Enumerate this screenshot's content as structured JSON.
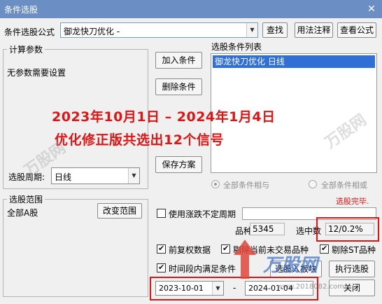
{
  "window": {
    "title": "条件选股",
    "close_glyph": "✕"
  },
  "formula": {
    "label": "条件选股公式",
    "value": "御龙快刀优化  -",
    "find_label": "查找",
    "usage_label": "用法注释",
    "view_label": "查看公式"
  },
  "params": {
    "legend": "计算参数",
    "note": "无参数需要设置"
  },
  "period": {
    "label": "选股周期:",
    "value": "日线"
  },
  "range": {
    "legend": "选股范围",
    "value": "全部A股",
    "change_label": "改变范围"
  },
  "actions": {
    "add_label": "加入条件",
    "remove_label": "删除条件",
    "save_label": "保存方案"
  },
  "conditions": {
    "legend": "选股条件列表",
    "items": [
      "御龙快刀优化  日线"
    ]
  },
  "logic": {
    "all_and_label": "全部条件相与",
    "all_or_label": "全部条件相或"
  },
  "status": {
    "done_text": "选股完毕."
  },
  "variable_period": {
    "label": "使用涨跌不定周期",
    "value": ""
  },
  "stats": {
    "count_label": "品种数",
    "count_value": "5345",
    "selected_label": "选中数",
    "selected_value": "12/0.2%"
  },
  "options": {
    "fq_label": "前复权数据",
    "exclude_untraded_label": "剔除当前未交易品种",
    "exclude_st_label": "剔除ST品种",
    "time_range_label": "时间段内满足条件"
  },
  "dates": {
    "start": "2023-10-01",
    "separator": "-",
    "end": "2024-01-04"
  },
  "bottom_buttons": {
    "stock_label": "选股入板块",
    "exec_label": "执行选股",
    "close_label": "关闭"
  },
  "overlay": {
    "line1": "2023年10月1日 – 2024年1月4日",
    "line2": "优化修正版共选出12个信号"
  },
  "watermark": {
    "brand": "万股网",
    "url": "www.2018082.com"
  },
  "colors": {
    "title_bar": "#6b8fc4",
    "overlay_text": "#e11414",
    "highlight_box": "#e11414",
    "selection_bg": "#2f6fd6"
  }
}
